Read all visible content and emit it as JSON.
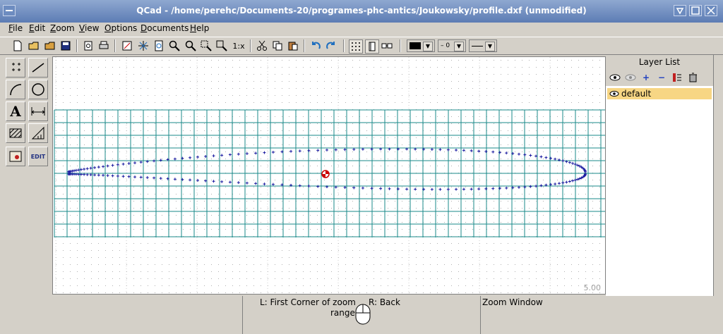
{
  "window": {
    "title": "QCad - /home/perehc/Documents-20/programes-phc-antics/Joukowsky/profile.dxf (unmodified)"
  },
  "menu": [
    {
      "label": "File",
      "ul": "F",
      "rest": "ile"
    },
    {
      "label": "Edit",
      "ul": "E",
      "rest": "dit"
    },
    {
      "label": "Zoom",
      "ul": "Z",
      "rest": "oom"
    },
    {
      "label": "View",
      "ul": "V",
      "rest": "iew"
    },
    {
      "label": "Options",
      "ul": "O",
      "rest": "ptions"
    },
    {
      "label": "Documents",
      "ul": "D",
      "rest": "ocuments"
    },
    {
      "label": "Help",
      "ul": "H",
      "rest": "elp"
    }
  ],
  "toolbar": {
    "zoom_1x": "1:x",
    "line_width": "0",
    "colors": {
      "pen": "#000000",
      "accent_undo": "#1f6fbf",
      "grid": "#1a8a8a",
      "points": "#1a1aa0",
      "selection": "#f7d684"
    }
  },
  "left_tools": [
    "points-tool",
    "line-tool",
    "arc-tool",
    "circle-tool",
    "text-tool",
    "dimension-tool",
    "hatch-tool",
    "measure-tool",
    "image-tool",
    "edit-tool"
  ],
  "left_tool_texts": {
    "text": "A",
    "edit": "EDIT"
  },
  "canvas": {
    "scale_label": "5.00"
  },
  "layer_list": {
    "title": "Layer List",
    "layers": [
      {
        "name": "default"
      }
    ]
  },
  "status": {
    "left_line1": "L: First Corner of zoom",
    "left_line2": "range",
    "right_button": "R: Back",
    "command": "Zoom Window"
  }
}
